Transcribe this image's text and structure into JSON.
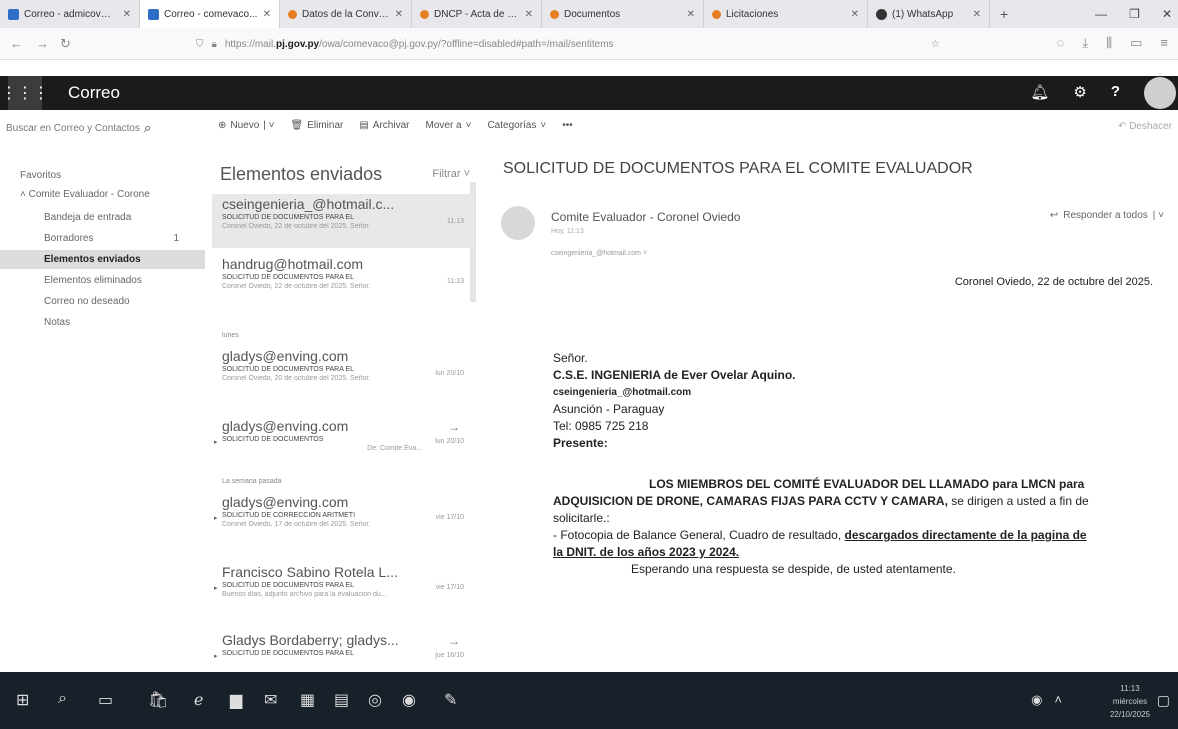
{
  "browser": {
    "tabs": [
      {
        "title": "Correo - admicov@pj",
        "icon": "outlook-icon",
        "active": false
      },
      {
        "title": "Correo - comevaco...",
        "icon": "outlook-icon",
        "active": true
      },
      {
        "title": "Datos de la Convocat",
        "icon": "dncp-icon",
        "active": false
      },
      {
        "title": "DNCP - Acta de apertura",
        "icon": "dncp-icon",
        "active": false
      },
      {
        "title": "Documentos",
        "icon": "dncp-icon",
        "active": false
      },
      {
        "title": "Licitaciones",
        "icon": "dncp-icon",
        "active": false
      },
      {
        "title": "(1) WhatsApp",
        "icon": "whatsapp-icon",
        "active": false
      }
    ],
    "new_tab": "+",
    "url_prefix": "https://mail.",
    "url_host": "pj.gov.py",
    "url_rest": "/owa/comevaco@pj.gov.py/?offline=disabled#path=/mail/sentitems"
  },
  "owa": {
    "app_title": "Correo",
    "search_placeholder": "Buscar en Correo y Contactos",
    "commands": {
      "new": "Nuevo",
      "delete": "Eliminar",
      "archive": "Archivar",
      "move": "Mover a",
      "categories": "Categorías",
      "more": "•••"
    },
    "undo": "Deshacer"
  },
  "folders": {
    "favorites": "Favoritos",
    "account": "Comite Evaluador - Corone",
    "items": [
      {
        "label": "Bandeja de entrada",
        "count": ""
      },
      {
        "label": "Borradores",
        "count": "1"
      },
      {
        "label": "Elementos enviados",
        "count": ""
      },
      {
        "label": "Elementos eliminados",
        "count": ""
      },
      {
        "label": "Correo no deseado",
        "count": ""
      },
      {
        "label": "Notas",
        "count": ""
      }
    ]
  },
  "message_list": {
    "title": "Elementos enviados",
    "filter": "Filtrar",
    "groups": {
      "lunes": "lunes",
      "last_week": "La semana pasada"
    },
    "messages": [
      {
        "from": "cseingenieria_@hotmail.c...",
        "subject": "SOLICITUD DE DOCUMENTOS PARA EL",
        "time": "11:13",
        "preview": "Coronel Oviedo, 22 de octubre del 2025. Señor."
      },
      {
        "from": "handrug@hotmail.com",
        "subject": "SOLICITUD DE DOCUMENTOS PARA EL",
        "time": "11:13",
        "preview": "Coronel Oviedo, 22 de octubre del 2025. Señor."
      },
      {
        "from": "gladys@enving.com",
        "subject": "SOLICITUD DE DOCUMENTOS PARA EL",
        "time": "lun 20/10",
        "preview": "Coronel Oviedo, 20 de octubre del 2025. Señor."
      },
      {
        "from": "gladys@enving.com",
        "subject": "SOLICITUD DE DOCUMENTOS",
        "time": "lun 20/10",
        "preview": "De: Comite Eva..."
      },
      {
        "from": "gladys@enving.com",
        "subject": "SOLICITUD DE CORRECCION ARITMETI",
        "time": "vie 17/10",
        "preview": "Coronel Oviedo, 17 de octubre del 2025. Señor."
      },
      {
        "from": "Francisco Sabino Rotela L...",
        "subject": "SOLICITUD DE DOCUMENTOS PARA EL",
        "time": "vie 17/10",
        "preview": "Buenos días, adjunto archivo para la evaluación du..."
      },
      {
        "from": "Gladys Bordaberry; gladys...",
        "subject": "SOLICITUD DE DOCUMENTOS PARA EL",
        "time": "jue 16/10",
        "preview": ""
      }
    ]
  },
  "reading": {
    "subject": "SOLICITUD DE DOCUMENTOS PARA EL COMITE EVALUADOR",
    "sender": "Comite Evaluador - Coronel Oviedo",
    "date": "Hoy, 11:13",
    "to": "cseingenieria_@hotmail.com",
    "reply_all": "Responder a todos",
    "body": {
      "place_date": "Coronel Oviedo, 22 de octubre del 2025.",
      "salutation": "Señor.",
      "company": "C.S.E. INGENIERIA de Ever Ovelar Aquino.",
      "email": "cseingenieria_@hotmail.com",
      "city": "Asunción - Paraguay",
      "tel": "Tel: 0985 725 218",
      "presente": "Presente:",
      "title_bold_1": "LOS MIEMBROS DEL COMITÉ EVALUADOR DEL LLAMADO  para LMCN para",
      "title_bold_2": "ADQUISICION DE DRONE, CAMARAS FIJAS PARA CCTV Y CAMARA,",
      "title_rest": " se dirigen a usted a fin de",
      "solicit": "solicitarle.:",
      "item_prefix": "- Fotocopia de Balance General, Cuadro de resultado, ",
      "item_underline_1": "descargados directamente de la pagina de",
      "item_underline_2": "la DNIT. de los años 2023 y 2024.",
      "closing": "Esperando una respuesta se despide, de usted atentamente."
    }
  },
  "taskbar": {
    "time": "11:13",
    "day": "miércoles",
    "date": "22/10/2025"
  }
}
